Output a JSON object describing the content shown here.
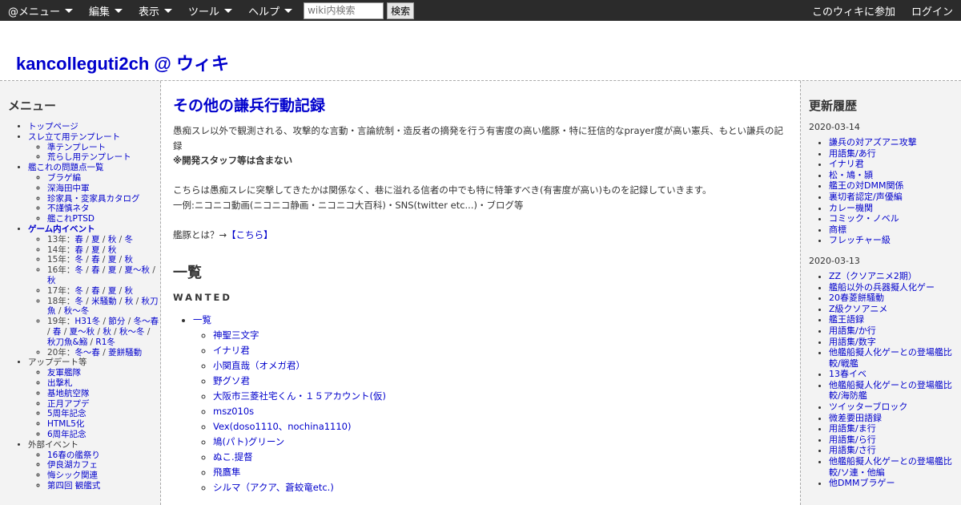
{
  "topbar": {
    "menus": [
      {
        "label": "@メニュー"
      },
      {
        "label": "編集"
      },
      {
        "label": "表示"
      },
      {
        "label": "ツール"
      },
      {
        "label": "ヘルプ"
      }
    ],
    "search_placeholder": "wiki内検索",
    "search_button": "検索",
    "join": "このウィキに参加",
    "login": "ログイン"
  },
  "site_title": "kancolleguti2ch @ ウィキ",
  "left": {
    "heading": "メニュー",
    "item_top": "トップページ",
    "item_template": "スレ立て用テンプレート",
    "item_template_sub": [
      "準テンプレート",
      "荒らし用テンプレート"
    ],
    "item_problems": "艦これの問題点一覧",
    "item_problems_sub": [
      "ブラゲ編",
      "深海田中軍",
      "珍家具・変家具カタログ",
      "不謹慎ネタ",
      "艦これPTSD"
    ],
    "item_events": "ゲーム内イベント",
    "events": {
      "y13": "13年：",
      "y13_links": [
        "春",
        "夏",
        "秋",
        "冬"
      ],
      "y14": "14年：",
      "y14_links": [
        "春",
        "夏",
        "秋"
      ],
      "y15": "15年：",
      "y15_links": [
        "冬",
        "春",
        "夏",
        "秋"
      ],
      "y16": "16年：",
      "y16_links": [
        "冬",
        "春",
        "夏",
        "夏～秋",
        "秋"
      ],
      "y17": "17年：",
      "y17_links": [
        "冬",
        "春",
        "夏",
        "秋"
      ],
      "y18": "18年：",
      "y18_links": [
        "冬",
        "米騒動",
        "秋",
        "秋刀魚",
        "秋〜冬"
      ],
      "y19": "19年：",
      "y19_links": [
        "H31冬",
        "節分",
        "冬〜春",
        "春",
        "夏〜秋",
        "秋",
        "秋～冬",
        "秋刀魚&鰯",
        "R1冬"
      ],
      "y20": "20年：",
      "y20_links": [
        "冬〜春",
        "菱餅騒動"
      ]
    },
    "item_updates": "アップデート等",
    "item_updates_sub": [
      "友軍艦隊",
      "出撃札",
      "基地航空隊",
      "正月アプデ",
      "5周年記念",
      "HTML5化",
      "6周年記念"
    ],
    "item_external": "外部イベント",
    "item_external_sub": [
      "16春の艦祭り",
      "伊良湖カフェ",
      "悔シック関連",
      "第四回 観艦式"
    ]
  },
  "main": {
    "title": "その他の謙兵行動記録",
    "intro": "愚痴スレ以外で観測される、攻撃的な言動・言論統制・造反者の摘発を行う有害度の高い艦豚・特に狂信的なprayer度が高い憲兵、もとい謙兵の記録",
    "note": "※開発スタッフ等は含まない",
    "para2": "こちらは愚痴スレに突撃してきたかは関係なく、巷に溢れる信者の中でも特に特筆すべき(有害度が高い)ものを記録していきます。",
    "para3": "一例:ニコニコ動画(ニコニコ静画・ニコニコ大百科)・SNS(twitter etc...)・ブログ等",
    "para4_prefix": "艦豚とは？→",
    "para4_link": "【こちら】",
    "h2": "一覧",
    "h3": "WANTED",
    "list_top": "一覧",
    "list_items": [
      "神聖三文字",
      "イナリ君",
      "小関直哉（オメガ君）",
      "野グソ君",
      "大阪市三菱社宅くん・１５アカウント(仮)",
      "msz010s",
      "Vex(doso1110、nochina1110)",
      "鳩(パト)グリーン",
      "ぬこ.提督",
      "飛鷹隼",
      "シルマ（アクア、蒼蛟竜etc.)"
    ]
  },
  "right": {
    "heading": "更新履歴",
    "date1": "2020-03-14",
    "list1": [
      "謙兵の対アズアニ攻撃",
      "用語集/あ行",
      "イナリ君",
      "松・鳩・頴",
      "艦王の対DMM関係",
      "裏切者認定/声優編",
      "カレー機関",
      "コミック・ノベル",
      "商標",
      "フレッチャー級"
    ],
    "date2": "2020-03-13",
    "list2": [
      "ZZ（クソアニメ2期）",
      "艦船以外の兵器擬人化ゲー",
      "20春菱餅騒動",
      "Z級クソアニメ",
      "艦王語録",
      "用語集/か行",
      "用語集/数字",
      "他艦船擬人化ゲーとの登場艦比較/戦艦",
      "13春イベ",
      "他艦船擬人化ゲーとの登場艦比較/海防艦",
      "ツイッターブロック",
      "微差要田語録",
      "用語集/ま行",
      "用語集/ら行",
      "用語集/さ行",
      "他艦船擬人化ゲーとの登場艦比較/ソ連・他編",
      "他DMMブラゲー"
    ]
  }
}
